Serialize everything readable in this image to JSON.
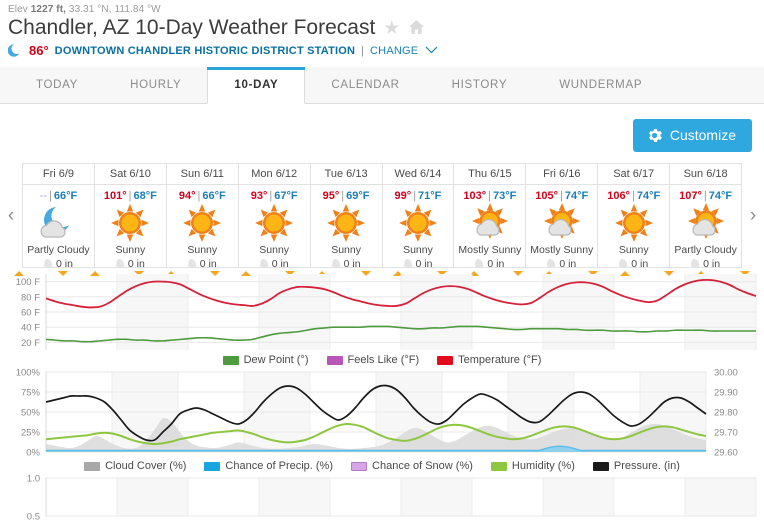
{
  "header": {
    "elev_prefix": "Elev",
    "elev_value": "1227 ft,",
    "coords": "33.31 °N, 111.84 °W",
    "title": "Chandler, AZ 10-Day Weather Forecast",
    "star_icon": "star-icon",
    "home_icon": "home-icon",
    "current_temp": "86°",
    "moon_icon": "moon-icon",
    "station": "DOWNTOWN CHANDLER HISTORIC DISTRICT STATION",
    "separator": "|",
    "change_label": "CHANGE",
    "chevron_icon": "chevron-down-icon"
  },
  "tabs": [
    {
      "label": "TODAY",
      "active": false
    },
    {
      "label": "HOURLY",
      "active": false
    },
    {
      "label": "10-DAY",
      "active": true
    },
    {
      "label": "CALENDAR",
      "active": false
    },
    {
      "label": "HISTORY",
      "active": false
    },
    {
      "label": "WUNDERMAP",
      "active": false
    }
  ],
  "toolbar": {
    "customize_label": "Customize",
    "gear_icon": "gear-icon"
  },
  "nav": {
    "prev_icon": "chevron-left-icon",
    "next_icon": "chevron-right-icon"
  },
  "forecast": {
    "unit": "°F",
    "precip_unit": "0 in",
    "days": [
      {
        "date": "Fri 6/9",
        "high": "--",
        "low": "66",
        "condition": "Partly Cloudy",
        "precip": "0 in",
        "icon": "moon-cloud-icon"
      },
      {
        "date": "Sat 6/10",
        "high": "101°",
        "low": "68",
        "condition": "Sunny",
        "precip": "0 in",
        "icon": "sun-icon"
      },
      {
        "date": "Sun 6/11",
        "high": "94°",
        "low": "66",
        "condition": "Sunny",
        "precip": "0 in",
        "icon": "sun-icon"
      },
      {
        "date": "Mon 6/12",
        "high": "93°",
        "low": "67",
        "condition": "Sunny",
        "precip": "0 in",
        "icon": "sun-icon"
      },
      {
        "date": "Tue 6/13",
        "high": "95°",
        "low": "69",
        "condition": "Sunny",
        "precip": "0 in",
        "icon": "sun-icon"
      },
      {
        "date": "Wed 6/14",
        "high": "99°",
        "low": "71",
        "condition": "Sunny",
        "precip": "0 in",
        "icon": "sun-icon"
      },
      {
        "date": "Thu 6/15",
        "high": "103°",
        "low": "73",
        "condition": "Mostly Sunny",
        "precip": "0 in",
        "icon": "sun-cloud-icon"
      },
      {
        "date": "Fri 6/16",
        "high": "105°",
        "low": "74",
        "condition": "Mostly Sunny",
        "precip": "0 in",
        "icon": "sun-cloud-icon"
      },
      {
        "date": "Sat 6/17",
        "high": "106°",
        "low": "74",
        "condition": "Sunny",
        "precip": "0 in",
        "icon": "sun-icon"
      },
      {
        "date": "Sun 6/18",
        "high": "107°",
        "low": "74",
        "condition": "Partly Cloudy",
        "precip": "0 in",
        "icon": "sun-cloud-icon"
      }
    ]
  },
  "chart_data": [
    {
      "type": "line",
      "id": "temperature-chart",
      "title": "",
      "xlabel": "",
      "ylabel": "",
      "ylim": [
        10,
        110
      ],
      "yticks": [
        20,
        40,
        60,
        80,
        100
      ],
      "ytick_labels": [
        "20 F",
        "40 F",
        "60 F",
        "80 F",
        "100 F"
      ],
      "grid": true,
      "legend_position": "bottom",
      "legend": [
        "Dew Point (°)",
        "Feels Like (°F)",
        "Temperature (°F)"
      ],
      "colors": {
        "dew_point": "#4e9a3e",
        "feels_like": "#b756b7",
        "temperature": "#d6213a"
      },
      "x": [
        0,
        1,
        2,
        3,
        4,
        5,
        6,
        7,
        8,
        9,
        10,
        11,
        12,
        13,
        14,
        15,
        16,
        17,
        18,
        19,
        20,
        21,
        22,
        23,
        24,
        25,
        26,
        27,
        28,
        29,
        30,
        31,
        32,
        33,
        34,
        35,
        36,
        37,
        38,
        39,
        40,
        41,
        42,
        43,
        44,
        45,
        46,
        47,
        48,
        49,
        50,
        51,
        52,
        53,
        54,
        55,
        56,
        57,
        58,
        59,
        60,
        61,
        62,
        63,
        64,
        65,
        66,
        67,
        68,
        69,
        70,
        71,
        72,
        73,
        74,
        75,
        76,
        77,
        78,
        79
      ],
      "series": [
        {
          "name": "Temperature (°F)",
          "values": [
            78,
            74,
            71,
            69,
            67,
            66,
            67,
            72,
            80,
            88,
            94,
            98,
            100,
            100,
            99,
            96,
            90,
            84,
            79,
            75,
            72,
            70,
            69,
            68,
            71,
            77,
            85,
            90,
            93,
            93,
            92,
            90,
            86,
            81,
            77,
            74,
            71,
            69,
            68,
            68,
            71,
            78,
            85,
            90,
            93,
            94,
            93,
            90,
            85,
            80,
            76,
            73,
            71,
            70,
            72,
            79,
            87,
            93,
            97,
            99,
            99,
            97,
            93,
            87,
            82,
            78,
            75,
            73,
            75,
            82,
            90,
            96,
            100,
            102,
            102,
            100,
            96,
            90,
            85,
            81
          ]
        },
        {
          "name": "Dew Point (°)",
          "values": [
            24,
            23,
            22,
            22,
            21,
            21,
            22,
            23,
            24,
            24,
            23,
            23,
            22,
            22,
            23,
            24,
            25,
            26,
            26,
            25,
            24,
            23,
            23,
            24,
            27,
            30,
            32,
            33,
            34,
            36,
            38,
            39,
            40,
            40,
            40,
            40,
            41,
            41,
            41,
            40,
            39,
            38,
            38,
            39,
            39,
            40,
            41,
            41,
            41,
            40,
            39,
            38,
            37,
            37,
            38,
            38,
            38,
            38,
            37,
            37,
            36,
            36,
            36,
            35,
            35,
            35,
            34,
            34,
            35,
            35,
            36,
            36,
            36,
            36,
            35,
            35,
            35,
            35,
            35,
            35
          ]
        },
        {
          "name": "Feels Like (°F)",
          "values": []
        }
      ]
    },
    {
      "type": "area",
      "id": "conditions-chart",
      "title": "",
      "xlabel": "",
      "ylabel": "",
      "ylim": [
        0,
        100
      ],
      "yticks": [
        0,
        25,
        50,
        75,
        100
      ],
      "ytick_labels": [
        "0%",
        "25%",
        "50%",
        "75%",
        "100%"
      ],
      "y2lim": [
        29.6,
        30.0
      ],
      "y2ticks": [
        29.6,
        29.7,
        29.8,
        29.9,
        30.0
      ],
      "y2tick_labels": [
        "29.60",
        "29.70",
        "29.80",
        "29.90",
        "30.00"
      ],
      "grid": true,
      "legend_position": "bottom",
      "legend": [
        "Cloud Cover (%)",
        "Chance of Precip. (%)",
        "Chance of Snow (%)",
        "Humidity (%)",
        "Pressure. (in)"
      ],
      "colors": {
        "cloud_cover": "#b5b5b5",
        "chance_of_precip": "#29a3dc",
        "chance_of_snow": "#c9a0dc",
        "humidity": "#8dc63f",
        "pressure": "#1a1a1a"
      },
      "x": [
        0,
        1,
        2,
        3,
        4,
        5,
        6,
        7,
        8,
        9,
        10,
        11,
        12,
        13,
        14,
        15,
        16,
        17,
        18,
        19,
        20,
        21,
        22,
        23,
        24,
        25,
        26,
        27,
        28,
        29,
        30,
        31,
        32,
        33,
        34,
        35,
        36,
        37,
        38,
        39,
        40,
        41,
        42,
        43,
        44,
        45,
        46,
        47,
        48,
        49,
        50,
        51,
        52,
        53,
        54,
        55,
        56,
        57,
        58,
        59,
        60,
        61,
        62,
        63,
        64,
        65,
        66,
        67,
        68,
        69,
        70,
        71,
        72,
        73,
        74,
        75,
        76,
        77,
        78,
        79
      ],
      "series": [
        {
          "name": "Pressure. (in)",
          "axis": "right",
          "values": [
            29.85,
            29.86,
            29.87,
            29.88,
            29.88,
            29.88,
            29.87,
            29.85,
            29.81,
            29.76,
            29.71,
            29.68,
            29.66,
            29.66,
            29.7,
            29.74,
            29.79,
            29.81,
            29.82,
            29.81,
            29.79,
            29.77,
            29.75,
            29.74,
            29.76,
            29.8,
            29.85,
            29.89,
            29.92,
            29.93,
            29.92,
            29.89,
            29.85,
            29.81,
            29.78,
            29.76,
            29.78,
            29.82,
            29.87,
            29.91,
            29.93,
            29.93,
            29.91,
            29.87,
            29.82,
            29.78,
            29.75,
            29.74,
            29.76,
            29.8,
            29.84,
            29.87,
            29.89,
            29.88,
            29.86,
            29.83,
            29.8,
            29.77,
            29.75,
            29.75,
            29.78,
            29.82,
            29.86,
            29.89,
            29.9,
            29.89,
            29.86,
            29.82,
            29.78,
            29.75,
            29.73,
            29.74,
            29.77,
            29.81,
            29.85,
            29.87,
            29.87,
            29.85,
            29.82,
            29.79
          ]
        },
        {
          "name": "Humidity (%)",
          "axis": "left",
          "values": [
            16,
            17,
            18,
            19,
            20,
            21,
            23,
            24,
            23,
            20,
            16,
            13,
            11,
            10,
            11,
            13,
            16,
            18,
            20,
            22,
            24,
            25,
            26,
            27,
            25,
            22,
            18,
            15,
            13,
            12,
            13,
            15,
            19,
            24,
            29,
            33,
            35,
            34,
            31,
            26,
            21,
            17,
            15,
            14,
            16,
            20,
            25,
            30,
            33,
            34,
            33,
            30,
            26,
            22,
            19,
            17,
            16,
            17,
            20,
            24,
            28,
            31,
            32,
            31,
            28,
            24,
            20,
            17,
            16,
            17,
            20,
            24,
            28,
            31,
            32,
            31,
            28,
            25,
            22,
            20
          ]
        },
        {
          "name": "Cloud Cover (%)",
          "axis": "left",
          "values": [
            10,
            8,
            6,
            5,
            8,
            14,
            20,
            16,
            10,
            6,
            4,
            6,
            14,
            28,
            42,
            38,
            25,
            14,
            8,
            6,
            5,
            6,
            9,
            12,
            10,
            7,
            5,
            4,
            4,
            5,
            6,
            8,
            10,
            9,
            7,
            5,
            4,
            4,
            5,
            6,
            8,
            12,
            18,
            25,
            30,
            28,
            22,
            16,
            12,
            14,
            20,
            26,
            31,
            33,
            30,
            25,
            20,
            17,
            16,
            18,
            22,
            26,
            29,
            30,
            28,
            24,
            20,
            17,
            16,
            18,
            24,
            30,
            34,
            35,
            33,
            29,
            24,
            20,
            17,
            15
          ]
        },
        {
          "name": "Chance of Precip. (%)",
          "axis": "left",
          "values": [
            2,
            2,
            2,
            2,
            2,
            2,
            2,
            2,
            2,
            2,
            2,
            2,
            2,
            2,
            2,
            2,
            2,
            2,
            2,
            2,
            2,
            2,
            2,
            2,
            2,
            2,
            2,
            2,
            2,
            2,
            2,
            2,
            2,
            2,
            2,
            2,
            2,
            2,
            2,
            2,
            2,
            2,
            2,
            2,
            2,
            2,
            2,
            2,
            2,
            2,
            2,
            2,
            2,
            2,
            2,
            2,
            2,
            2,
            2,
            2,
            5,
            7,
            7,
            5,
            2,
            2,
            2,
            2,
            2,
            2,
            2,
            2,
            2,
            2,
            2,
            2,
            2,
            2,
            2,
            2
          ]
        },
        {
          "name": "Chance of Snow (%)",
          "axis": "left",
          "values": []
        }
      ]
    },
    {
      "type": "line",
      "id": "third-chart",
      "title": "",
      "ylim": [
        0.5,
        1.0
      ],
      "yticks": [
        0.5,
        1.0
      ],
      "ytick_labels": [
        "0.5",
        "1.0"
      ],
      "grid": true,
      "legend": [],
      "series": []
    }
  ]
}
